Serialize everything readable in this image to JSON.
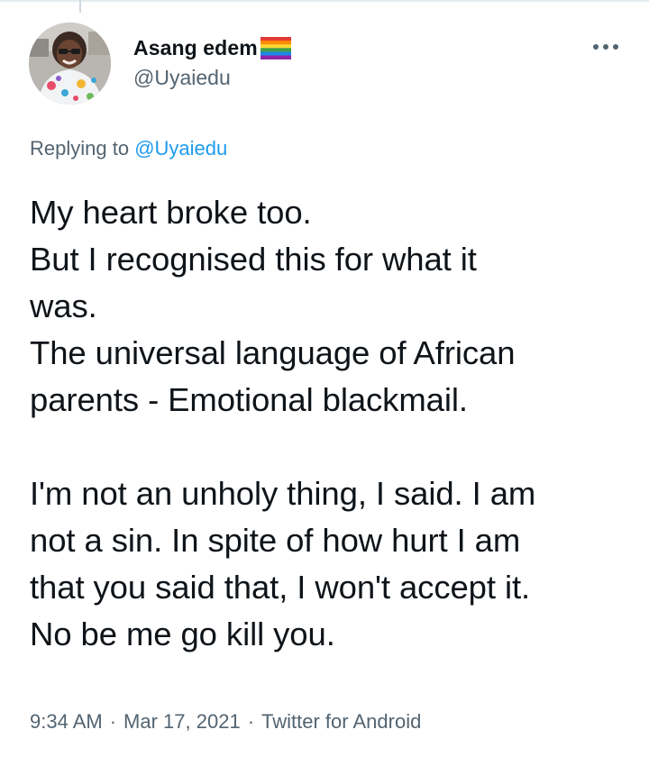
{
  "user": {
    "display_name": "Asang edem",
    "handle": "@Uyaiedu",
    "flag_icon": "rainbow-flag-icon"
  },
  "reply": {
    "prefix": "Replying to",
    "mention": "@Uyaiedu"
  },
  "tweet": {
    "lines": [
      "My heart broke too.",
      "But I recognised this for what it",
      "was.",
      "The universal language of African",
      "parents - Emotional blackmail.",
      "",
      "I'm not an unholy thing, I said. I am",
      "not a sin. In spite of how hurt I am",
      "that you said that, I won't accept it.",
      "No be me go kill you."
    ]
  },
  "meta": {
    "time": "9:34 AM",
    "date": "Mar 17, 2021",
    "source": "Twitter for Android",
    "separator": "·"
  },
  "icons": {
    "more": "more-options-icon"
  },
  "colors": {
    "text": "#0f1419",
    "secondary": "#536471",
    "link": "#1d9bf0"
  }
}
